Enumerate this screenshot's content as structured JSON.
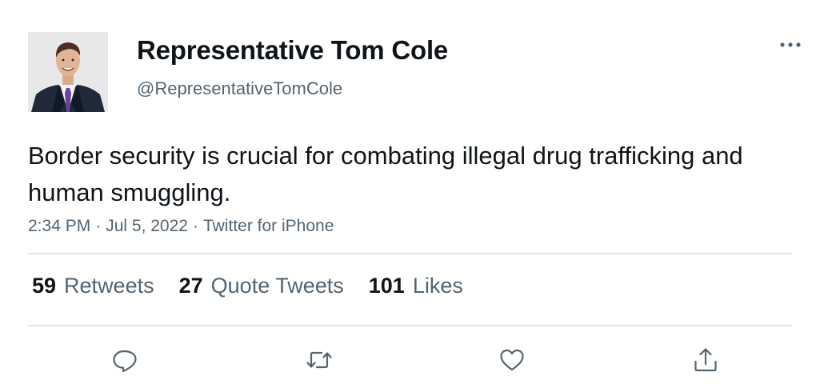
{
  "tweet": {
    "author": {
      "display_name": "Representative Tom Cole",
      "handle": "@RepresentativeTomCole",
      "avatar_icon": "profile-photo"
    },
    "text": "Border security is crucial for combating illegal drug trafficking and human smuggling.",
    "meta": {
      "time": "2:34 PM",
      "date": "Jul 5, 2022",
      "source": "Twitter for iPhone",
      "separator": "·"
    },
    "stats": [
      {
        "count": "59",
        "label": "Retweets"
      },
      {
        "count": "27",
        "label": "Quote Tweets"
      },
      {
        "count": "101",
        "label": "Likes"
      }
    ],
    "actions": [
      {
        "icon": "reply-icon"
      },
      {
        "icon": "retweet-icon"
      },
      {
        "icon": "like-icon"
      },
      {
        "icon": "share-icon"
      }
    ]
  },
  "colors": {
    "text_primary": "#0f1419",
    "text_secondary": "#536471",
    "divider": "#e1e3e6",
    "icon": "#536471"
  }
}
